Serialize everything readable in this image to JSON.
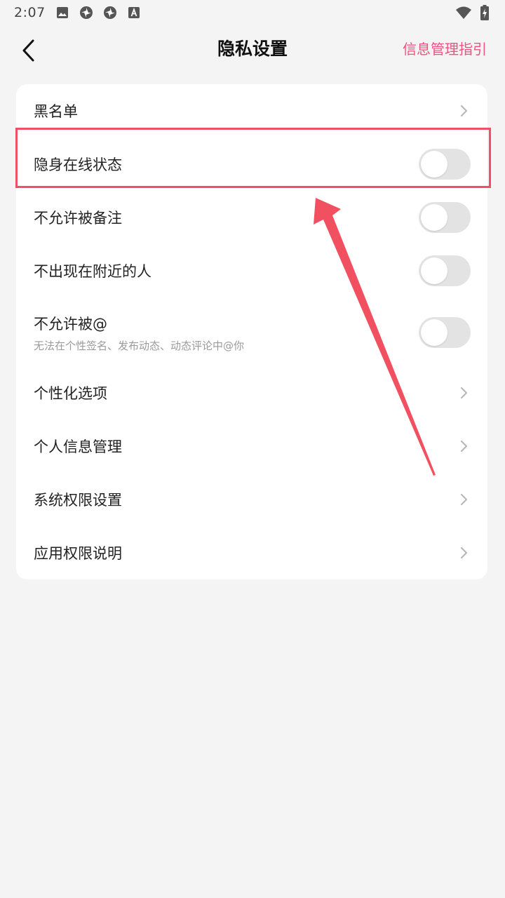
{
  "status_bar": {
    "time": "2:07",
    "left_icons": [
      "image-icon",
      "pinwheel-icon",
      "pinwheel-icon",
      "text-a-icon"
    ],
    "right_icons": [
      "wifi-icon",
      "battery-charging-icon"
    ]
  },
  "header": {
    "title": "隐私设置",
    "right_link": "信息管理指引",
    "accent_color": "#f0527f"
  },
  "settings": {
    "blacklist": {
      "label": "黑名单"
    },
    "invisible_status": {
      "label": "隐身在线状态",
      "toggle_on": false
    },
    "no_remarks": {
      "label": "不允许被备注",
      "toggle_on": false
    },
    "hide_nearby": {
      "label": "不出现在附近的人",
      "toggle_on": false
    },
    "no_mention": {
      "label": "不允许被@",
      "sublabel": "无法在个性签名、发布动态、动态评论中@你",
      "toggle_on": false
    },
    "personalization": {
      "label": "个性化选项"
    },
    "personal_info": {
      "label": "个人信息管理"
    },
    "system_permissions": {
      "label": "系统权限设置"
    },
    "app_permissions": {
      "label": "应用权限说明"
    }
  },
  "annotation": {
    "highlight_color": "#f05060",
    "target": "隐身在线状态"
  }
}
